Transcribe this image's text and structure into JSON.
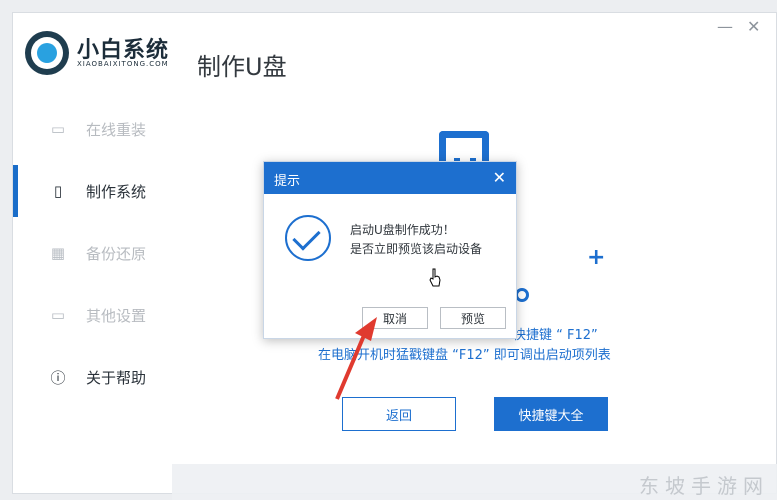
{
  "window": {
    "minimize_glyph": "—",
    "close_glyph": "✕"
  },
  "brand": {
    "name": "小白系统",
    "subtitle": "XIAOBAIXITONG.COM"
  },
  "page_title": "制作U盘",
  "sidebar": {
    "items": [
      {
        "label": "在线重装",
        "icon": "monitor-icon",
        "glyph": "▭"
      },
      {
        "label": "制作系统",
        "icon": "usb-icon",
        "glyph": "▯"
      },
      {
        "label": "备份还原",
        "icon": "grid-icon",
        "glyph": "▦"
      },
      {
        "label": "其他设置",
        "icon": "briefcase-icon",
        "glyph": "▭"
      },
      {
        "label": "关于帮助",
        "icon": "info-icon",
        "glyph": "ⓘ"
      }
    ],
    "active_index": 1
  },
  "main": {
    "hint_line1": "快捷键 “ F12”",
    "hint_line2": "在电脑开机时猛戳键盘 “F12” 即可调出启动项列表",
    "back_button": "返回",
    "shortcut_button": "快捷键大全"
  },
  "dialog": {
    "title": "提示",
    "close_glyph": "✕",
    "message_line1": "启动U盘制作成功！",
    "message_line2": "是否立即预览该启动设备",
    "cancel_button": "取消",
    "preview_button": "预览"
  },
  "watermark": "东坡手游网",
  "colors": {
    "accent": "#1d6fcf",
    "arrow": "#e03a2f"
  }
}
